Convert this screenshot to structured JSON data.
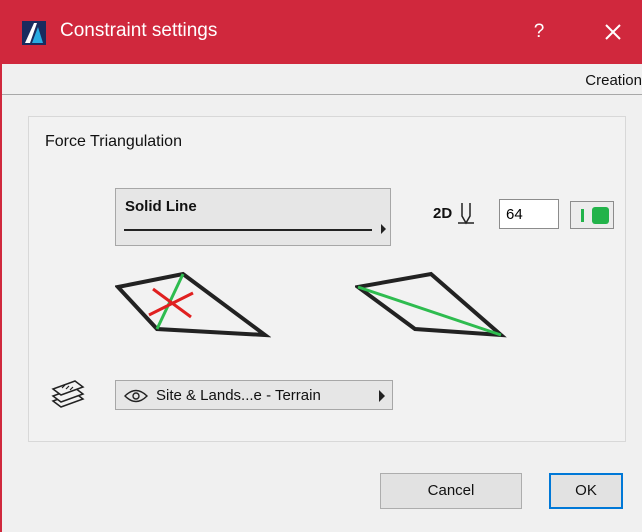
{
  "window": {
    "title": "Constraint settings",
    "help_label": "?"
  },
  "tab": {
    "label": "Creation"
  },
  "section": {
    "title": "Force Triangulation"
  },
  "line_type": {
    "label": "Solid Line"
  },
  "pen": {
    "dim_label": "2D",
    "value": "64",
    "color": "#22b34a"
  },
  "layer": {
    "label": "Site & Lands...e - Terrain"
  },
  "buttons": {
    "cancel": "Cancel",
    "ok": "OK"
  },
  "colors": {
    "titlebar": "#d0283d",
    "accent_green": "#22b34a",
    "mark_red": "#e02020",
    "focus_blue": "#0078d7"
  }
}
